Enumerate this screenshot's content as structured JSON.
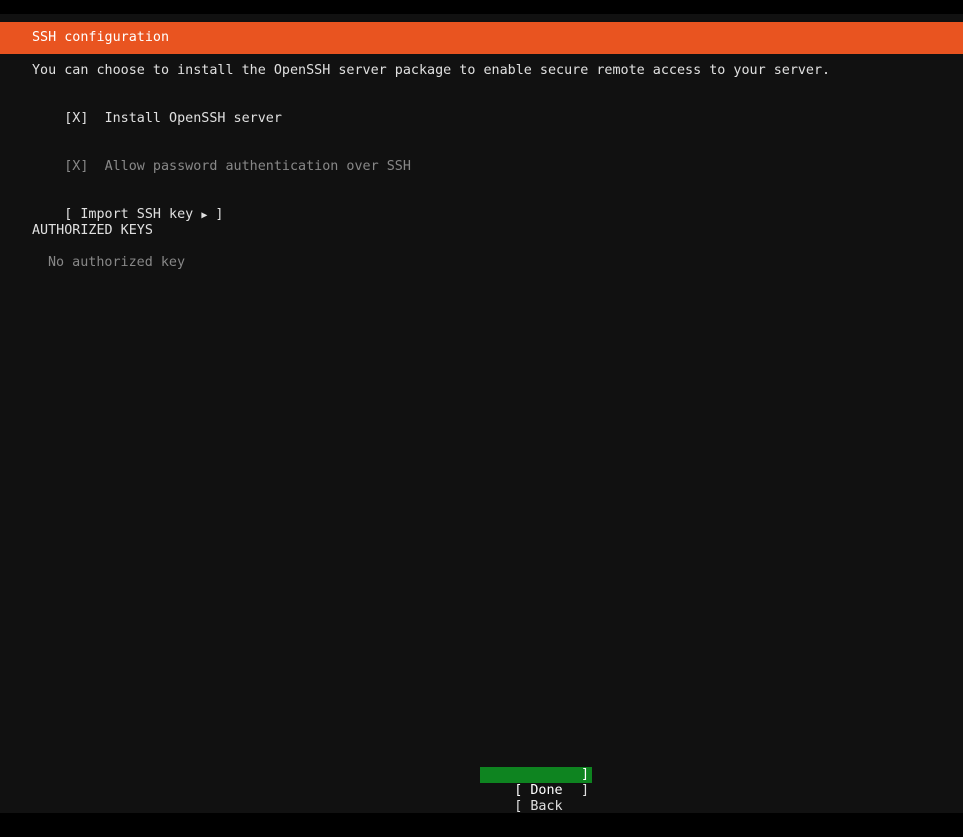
{
  "header": {
    "title": "SSH configuration"
  },
  "main": {
    "description": "You can choose to install the OpenSSH server package to enable secure remote access to your server.",
    "install_checkbox": {
      "mark": "[X]",
      "label": "Install OpenSSH server"
    },
    "password_checkbox": {
      "mark": "[X]",
      "label": "Allow password authentication over SSH"
    },
    "import_button": {
      "left_bracket": "[",
      "label": "Import SSH key",
      "arrow": "▶",
      "right_bracket": "]"
    },
    "authorized_keys": {
      "heading": "AUTHORIZED KEYS",
      "empty_text": "No authorized key"
    }
  },
  "footer": {
    "done": {
      "left_bracket": "[",
      "label": "Done",
      "right_bracket": "]"
    },
    "back": {
      "left_bracket": "[",
      "label": "Back",
      "right_bracket": "]"
    }
  },
  "colors": {
    "title_bar": "#e95420",
    "focus_button": "#0e8420",
    "background": "#111111"
  }
}
